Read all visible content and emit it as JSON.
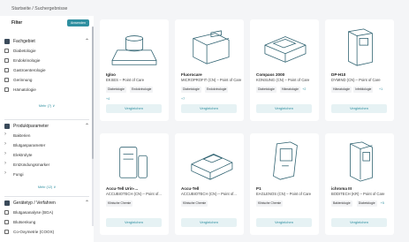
{
  "breadcrumb": "Startseite / Suchergebnisse",
  "filter": {
    "title": "Filter",
    "apply_label": "Anwenden",
    "sections": [
      {
        "label": "Fachgebiet",
        "options": [
          "Diabetologie",
          "Endokrinologie",
          "Gastroenterologie",
          "Gerinnung",
          "Hämatologie"
        ],
        "more": "Mehr (7) ∨"
      },
      {
        "label": "Produktparameter",
        "options": [
          "Bakterien",
          "Blutgasparameter",
          "Elektrolyte",
          "Entzündungsmarker",
          "Fungi"
        ],
        "more": "Mehr (12) ∨"
      },
      {
        "label": "Gerätetyp / Verfahren",
        "options": [
          "Blutgasanalyse (BGA)",
          "Blutsenkung",
          "Co-Oxymetrie (COOX)"
        ],
        "more": ""
      }
    ]
  },
  "compare_label": "Vergleichen",
  "products": [
    {
      "name": "Igloo",
      "maker": "EKSES – Point of Care",
      "tags": [
        "Diabetologie",
        "Endokrinologie"
      ],
      "count": "",
      "more": "+4"
    },
    {
      "name": "Fluorocare",
      "maker": "MICROPROFIT (CN) – Point of Care",
      "tags": [
        "Diabetologie",
        "Endokrinologie"
      ],
      "count": "",
      "more": "+7"
    },
    {
      "name": "Compass 2000",
      "maker": "KONSUNG (CN) – Point of Care",
      "tags": [
        "Diabetologie",
        "Hämatologie"
      ],
      "count": "+2",
      "more": ""
    },
    {
      "name": "DP-H10",
      "maker": "DYMIND (CN) – Point of Care",
      "tags": [
        "Hämatologie",
        "Infektiologie"
      ],
      "count": "+1",
      "more": ""
    },
    {
      "name": "Accu-Tell Urin-...",
      "maker": "ACCUBIOTECH (CN) – Point of...",
      "tags": [
        "Klinische Chemie"
      ],
      "count": "",
      "more": ""
    },
    {
      "name": "Accu-Tell",
      "maker": "ACCUBIOTECH (CN) – Point of...",
      "tags": [
        "Klinische Chemie"
      ],
      "count": "",
      "more": ""
    },
    {
      "name": "P1",
      "maker": "EAGLENOS (CN) – Point of Care",
      "tags": [
        "Klinische Chemie"
      ],
      "count": "",
      "more": ""
    },
    {
      "name": "ichroma III",
      "maker": "BODITECH (KR) – Point of Care",
      "tags": [
        "Bakteriologie",
        "Diabetologie"
      ],
      "count": "+5",
      "more": ""
    }
  ]
}
